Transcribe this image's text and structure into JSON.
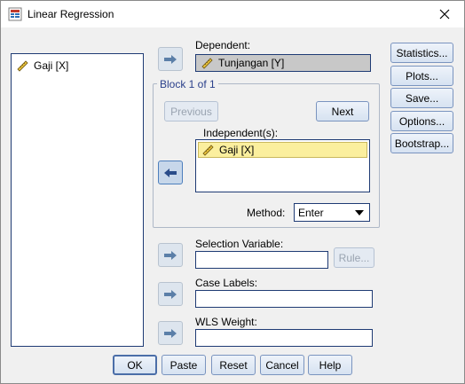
{
  "window": {
    "title": "Linear Regression"
  },
  "source_variables": [
    {
      "label": "Gaji [X]"
    }
  ],
  "dependent": {
    "label": "Dependent:",
    "value": "Tunjangan [Y]"
  },
  "block": {
    "title": "Block 1 of 1",
    "previous": "Previous",
    "next": "Next"
  },
  "independents": {
    "label": "Independent(s):",
    "items": [
      {
        "label": "Gaji [X]"
      }
    ]
  },
  "method": {
    "label": "Method:",
    "value": "Enter"
  },
  "selection_variable": {
    "label": "Selection Variable:",
    "rule": "Rule..."
  },
  "case_labels": {
    "label": "Case Labels:"
  },
  "wls_weight": {
    "label": "WLS Weight:"
  },
  "side_buttons": {
    "statistics": "Statistics...",
    "plots": "Plots...",
    "save": "Save...",
    "options": "Options...",
    "bootstrap": "Bootstrap..."
  },
  "bottom_buttons": {
    "ok": "OK",
    "paste": "Paste",
    "reset": "Reset",
    "cancel": "Cancel",
    "help": "Help"
  },
  "colors": {
    "accent": "#1f3b74",
    "block_title": "#2a3f8a",
    "highlight": "#fbef9e"
  },
  "icons": {
    "app": "spss-regression-icon",
    "variable": "scale-ruler-icon"
  }
}
